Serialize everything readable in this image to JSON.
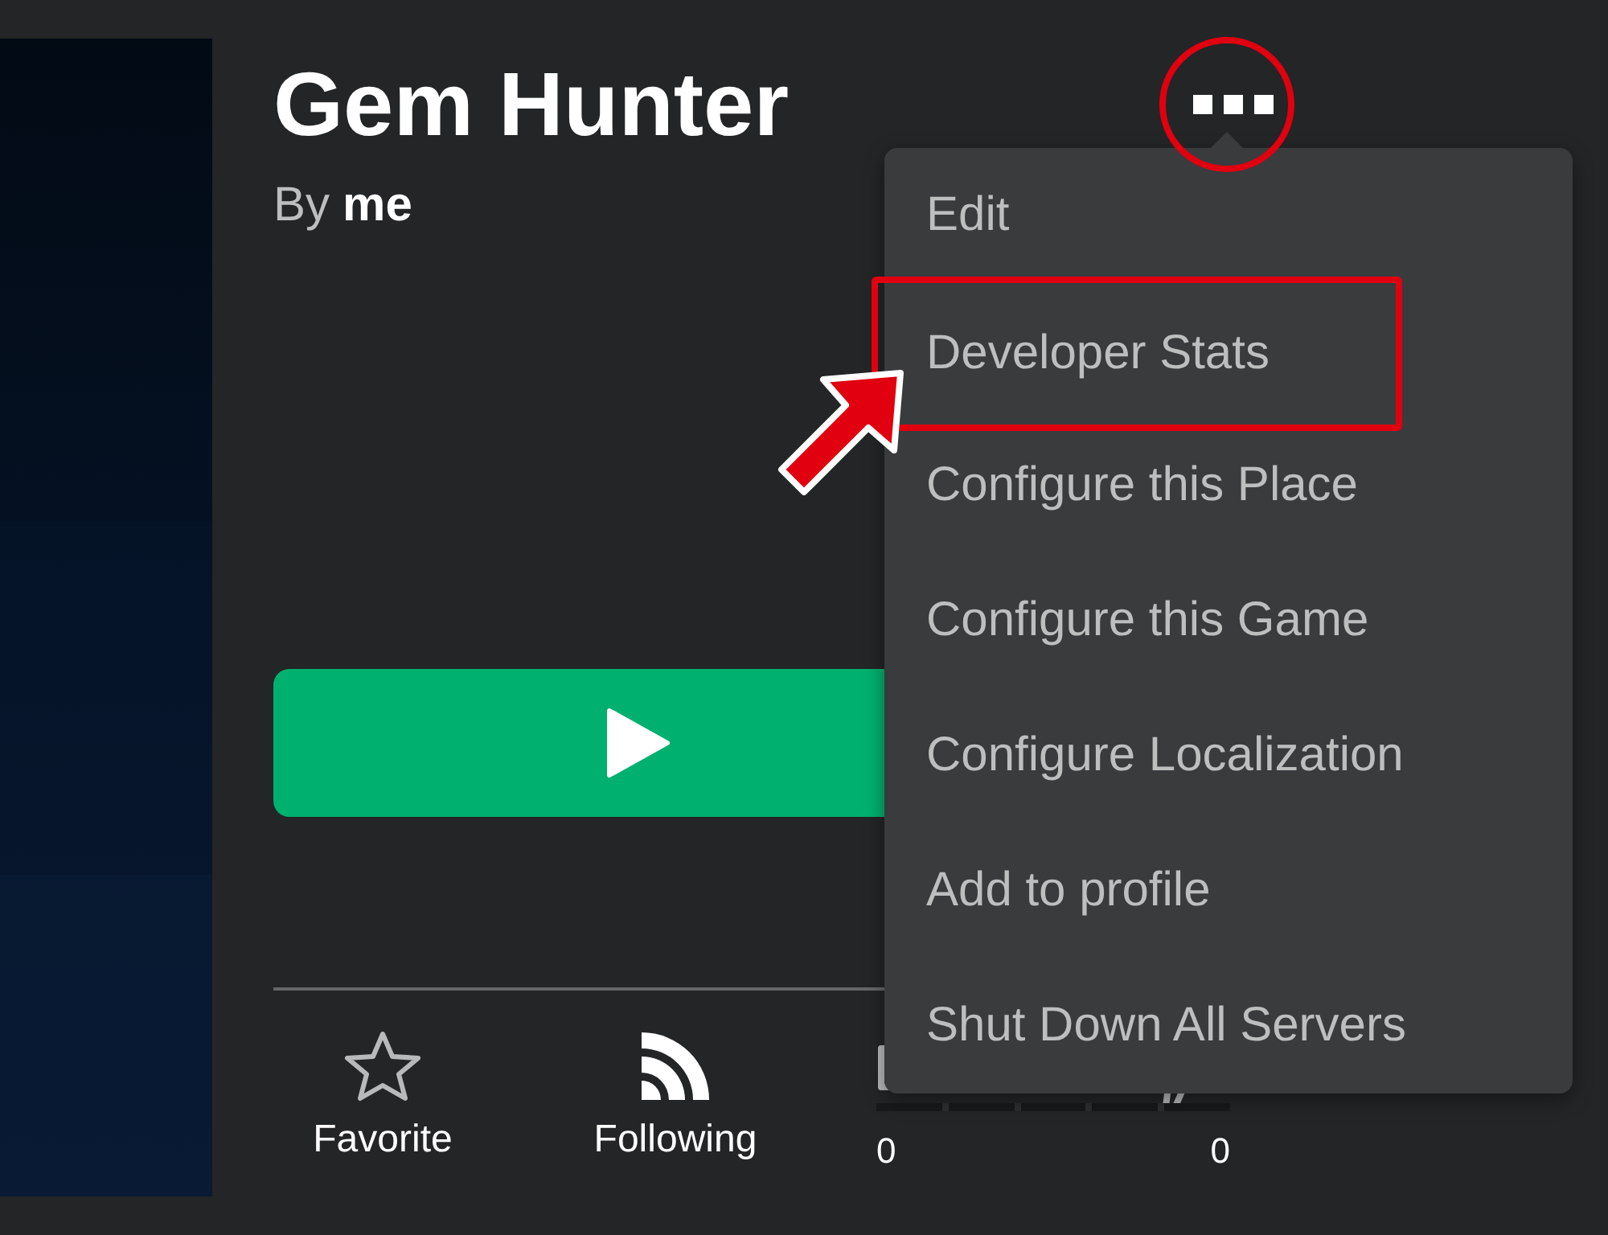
{
  "game": {
    "title": "Gem Hunter",
    "byline_prefix": "By",
    "creator": "me"
  },
  "menu": {
    "items": [
      {
        "label": "Edit",
        "highlighted": false
      },
      {
        "label": "Developer Stats",
        "highlighted": true
      },
      {
        "label": "Configure this Place",
        "highlighted": false
      },
      {
        "label": "Configure this Game",
        "highlighted": false
      },
      {
        "label": "Configure Localization",
        "highlighted": false
      },
      {
        "label": "Add to profile",
        "highlighted": false
      },
      {
        "label": "Shut Down All Servers",
        "highlighted": false
      }
    ]
  },
  "actions": [
    {
      "kind": "favorite",
      "label": "Favorite"
    },
    {
      "kind": "following",
      "label": "Following"
    }
  ],
  "votes": {
    "up": "0",
    "down": "0"
  }
}
